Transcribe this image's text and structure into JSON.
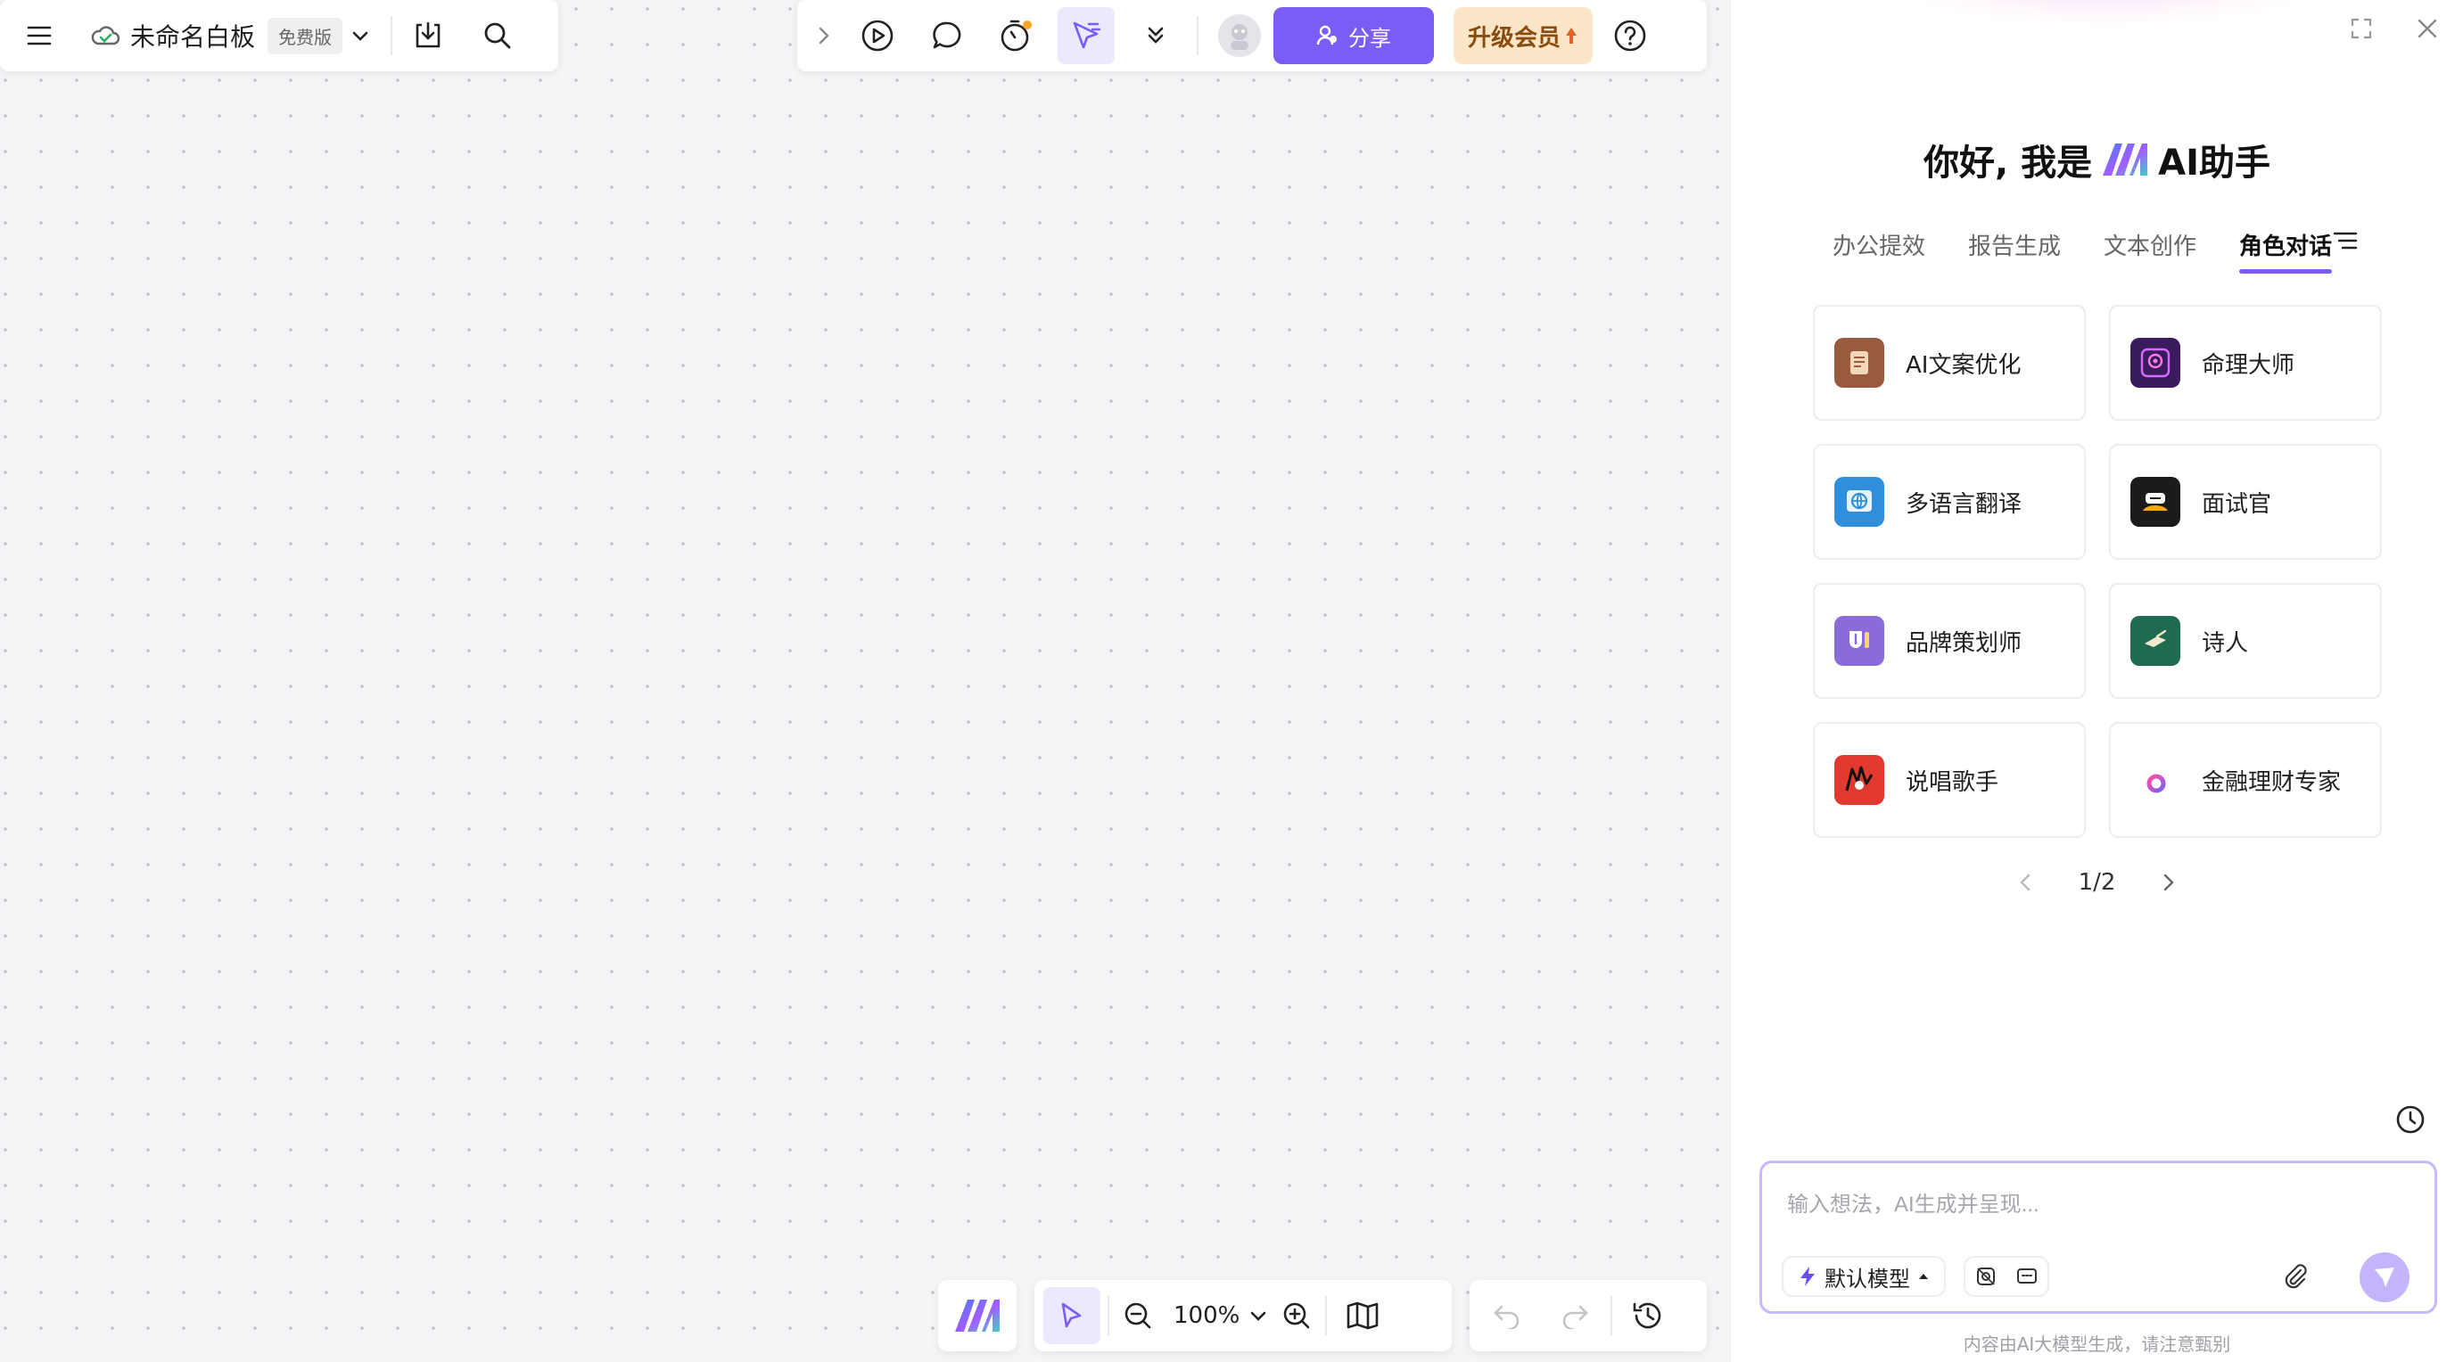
{
  "doc": {
    "title": "未命名白板",
    "plan_badge": "免费版"
  },
  "top": {
    "share_label": "分享",
    "upgrade_label": "升级会员"
  },
  "zoom": {
    "value": "100%"
  },
  "assistant": {
    "greeting_prefix": "你好, 我是",
    "greeting_suffix": "AI助手",
    "tabs": [
      {
        "label": "办公提效",
        "active": false
      },
      {
        "label": "报告生成",
        "active": false
      },
      {
        "label": "文本创作",
        "active": false
      },
      {
        "label": "角色对话",
        "active": true
      }
    ],
    "cards": [
      {
        "label": "AI文案优化",
        "icon": "copywriting-icon",
        "color": "#9a5a3d"
      },
      {
        "label": "命理大师",
        "icon": "fortune-icon",
        "color": "#3a1b5e"
      },
      {
        "label": "多语言翻译",
        "icon": "translate-icon",
        "color": "#2f8fdc"
      },
      {
        "label": "面试官",
        "icon": "interviewer-icon",
        "color": "#1b1b1b"
      },
      {
        "label": "品牌策划师",
        "icon": "brand-icon",
        "color": "#8a6cd9"
      },
      {
        "label": "诗人",
        "icon": "poet-icon",
        "color": "#1f6b4f"
      },
      {
        "label": "说唱歌手",
        "icon": "rapper-icon",
        "color": "#e33a2f"
      },
      {
        "label": "金融理财专家",
        "icon": "finance-icon",
        "color": "#ffffff"
      }
    ],
    "pager": "1/2",
    "input_placeholder": "输入想法，AI生成并呈现...",
    "model_label": "默认模型",
    "disclaimer": "内容由AI大模型生成，请注意甄别"
  },
  "colors": {
    "accent": "#7b5cf5",
    "vip_bg": "#fbe7c8",
    "vip_text": "#8a4b0f"
  }
}
